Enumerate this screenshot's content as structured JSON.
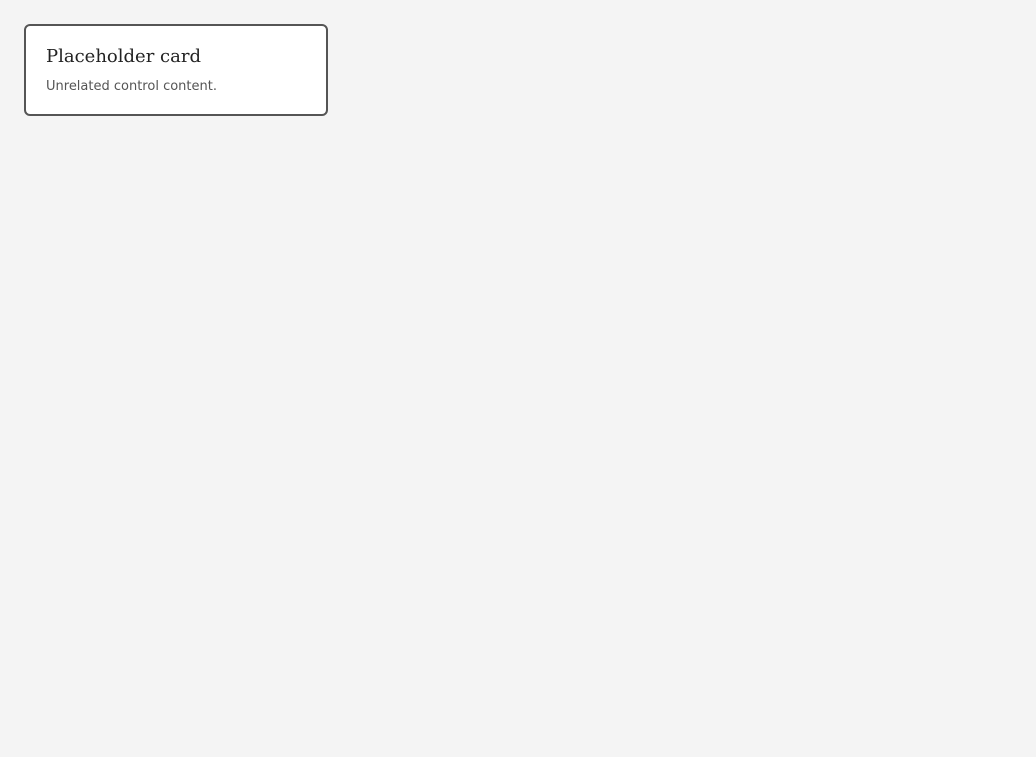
{
  "box": {
    "heading": "Placeholder card",
    "note": "Unrelated control content."
  }
}
